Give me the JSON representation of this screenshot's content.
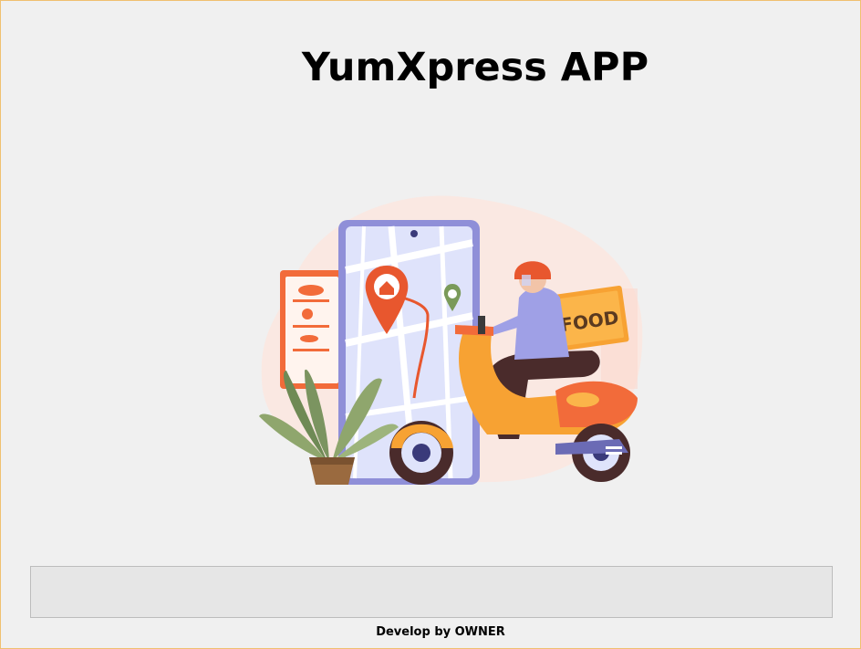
{
  "app": {
    "title": "YumXpress APP",
    "footer": "Develop by OWNER"
  },
  "illustration": {
    "box_label": "FOOD",
    "icon": "food-delivery-illustration"
  },
  "progress": {
    "value": 0
  },
  "colors": {
    "background": "#f0f0f0",
    "accent_orange": "#f26b3a",
    "phone_blue": "#9c9ee8",
    "scooter_orange": "#f7a233"
  }
}
